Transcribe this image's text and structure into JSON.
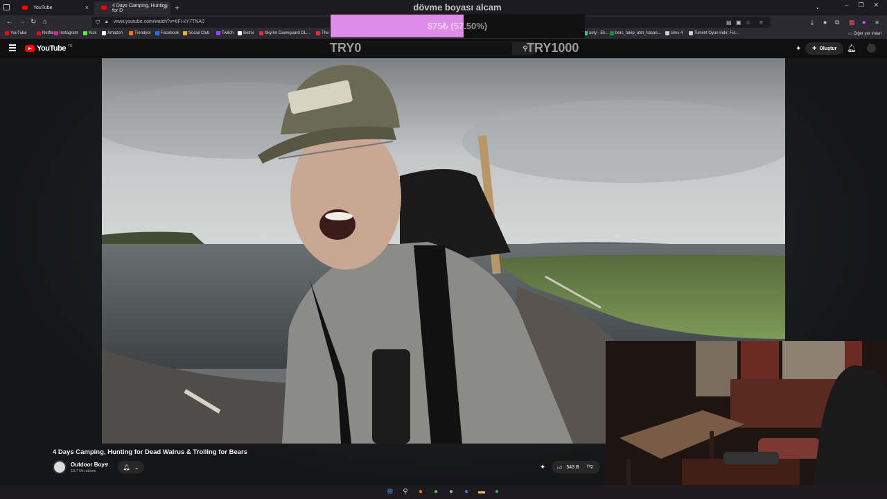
{
  "browser": {
    "tabs": [
      {
        "label": "YouTube",
        "active": false
      },
      {
        "label": "4 Days Camping, Hunting for D",
        "active": true
      }
    ],
    "new_tab_glyph": "+",
    "url": "www.youtube.com/watch?v=6FI-kY7TNA0",
    "bookmarks": [
      {
        "label": "YouTube",
        "color": "#ff0000"
      },
      {
        "label": "Netflix",
        "color": "#e50914"
      },
      {
        "label": "Instagram",
        "color": "#d6249f"
      },
      {
        "label": "Kick",
        "color": "#53fc18"
      },
      {
        "label": "Amazon",
        "color": "#ffffff"
      },
      {
        "label": "Trendyol",
        "color": "#f27a1a"
      },
      {
        "label": "Facebook",
        "color": "#1877f2"
      },
      {
        "label": "Social Club",
        "color": "#f4b400"
      },
      {
        "label": "Twitch",
        "color": "#9146ff"
      },
      {
        "label": "Botrix",
        "color": "#ffffff"
      },
      {
        "label": "Skyrim Dawnguard DL...",
        "color": "#d33"
      },
      {
        "label": "The I",
        "color": "#d33"
      },
      {
        "label": "asty - Ek...",
        "color": "#2ecc71"
      },
      {
        "label": "borc_takip_afet_hasan...",
        "color": "#1e8e3e"
      },
      {
        "label": "sims 4",
        "color": "#cccccc"
      },
      {
        "label": "Torrent Oyun indir, Ful...",
        "color": "#cccccc"
      }
    ],
    "other_bookmarks": "Diğer yer imleri"
  },
  "overlay": {
    "title": "dövme boyası alcam",
    "goal_text": "$75₺ (57.50%)",
    "goal_progress": 0.525,
    "goal_min": "TRY0",
    "goal_max": "TRY1000"
  },
  "youtube": {
    "logo": "YouTube",
    "country": "TR",
    "create_label": "Oluştur",
    "video_title": "4 Days Camping, Hunting for Dead Walrus & Trolling for Bears",
    "channel_name": "Outdoor Boys",
    "subscribers": "18,7 Mn abone",
    "likes": "543 B"
  },
  "colors": {
    "accent": "#ff0000",
    "goal_fill": "#dd8ce8"
  }
}
